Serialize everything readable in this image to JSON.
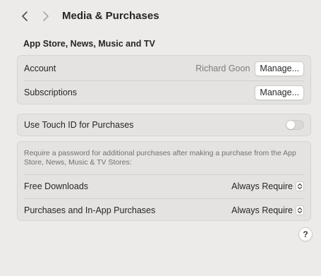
{
  "header": {
    "title": "Media & Purchases",
    "back_icon": "chevron-left-icon",
    "forward_icon": "chevron-right-icon"
  },
  "section": {
    "title": "App Store, News, Music and TV"
  },
  "account_card": {
    "account_label": "Account",
    "account_name": "Richard Goon",
    "account_button": "Manage...",
    "subscriptions_label": "Subscriptions",
    "subscriptions_button": "Manage..."
  },
  "touch_id": {
    "label": "Use Touch ID for Purchases",
    "enabled": false
  },
  "password_card": {
    "description": "Require a password for additional purchases after making a purchase from the App Store, News, Music & TV Stores:",
    "free_downloads_label": "Free Downloads",
    "free_downloads_value": "Always Require",
    "purchases_label": "Purchases and In-App Purchases",
    "purchases_value": "Always Require"
  },
  "help": {
    "label": "?"
  },
  "colors": {
    "background": "#ecebe9",
    "card": "#e4e3e1",
    "text": "#262626",
    "muted_text": "#7d7c7a"
  }
}
